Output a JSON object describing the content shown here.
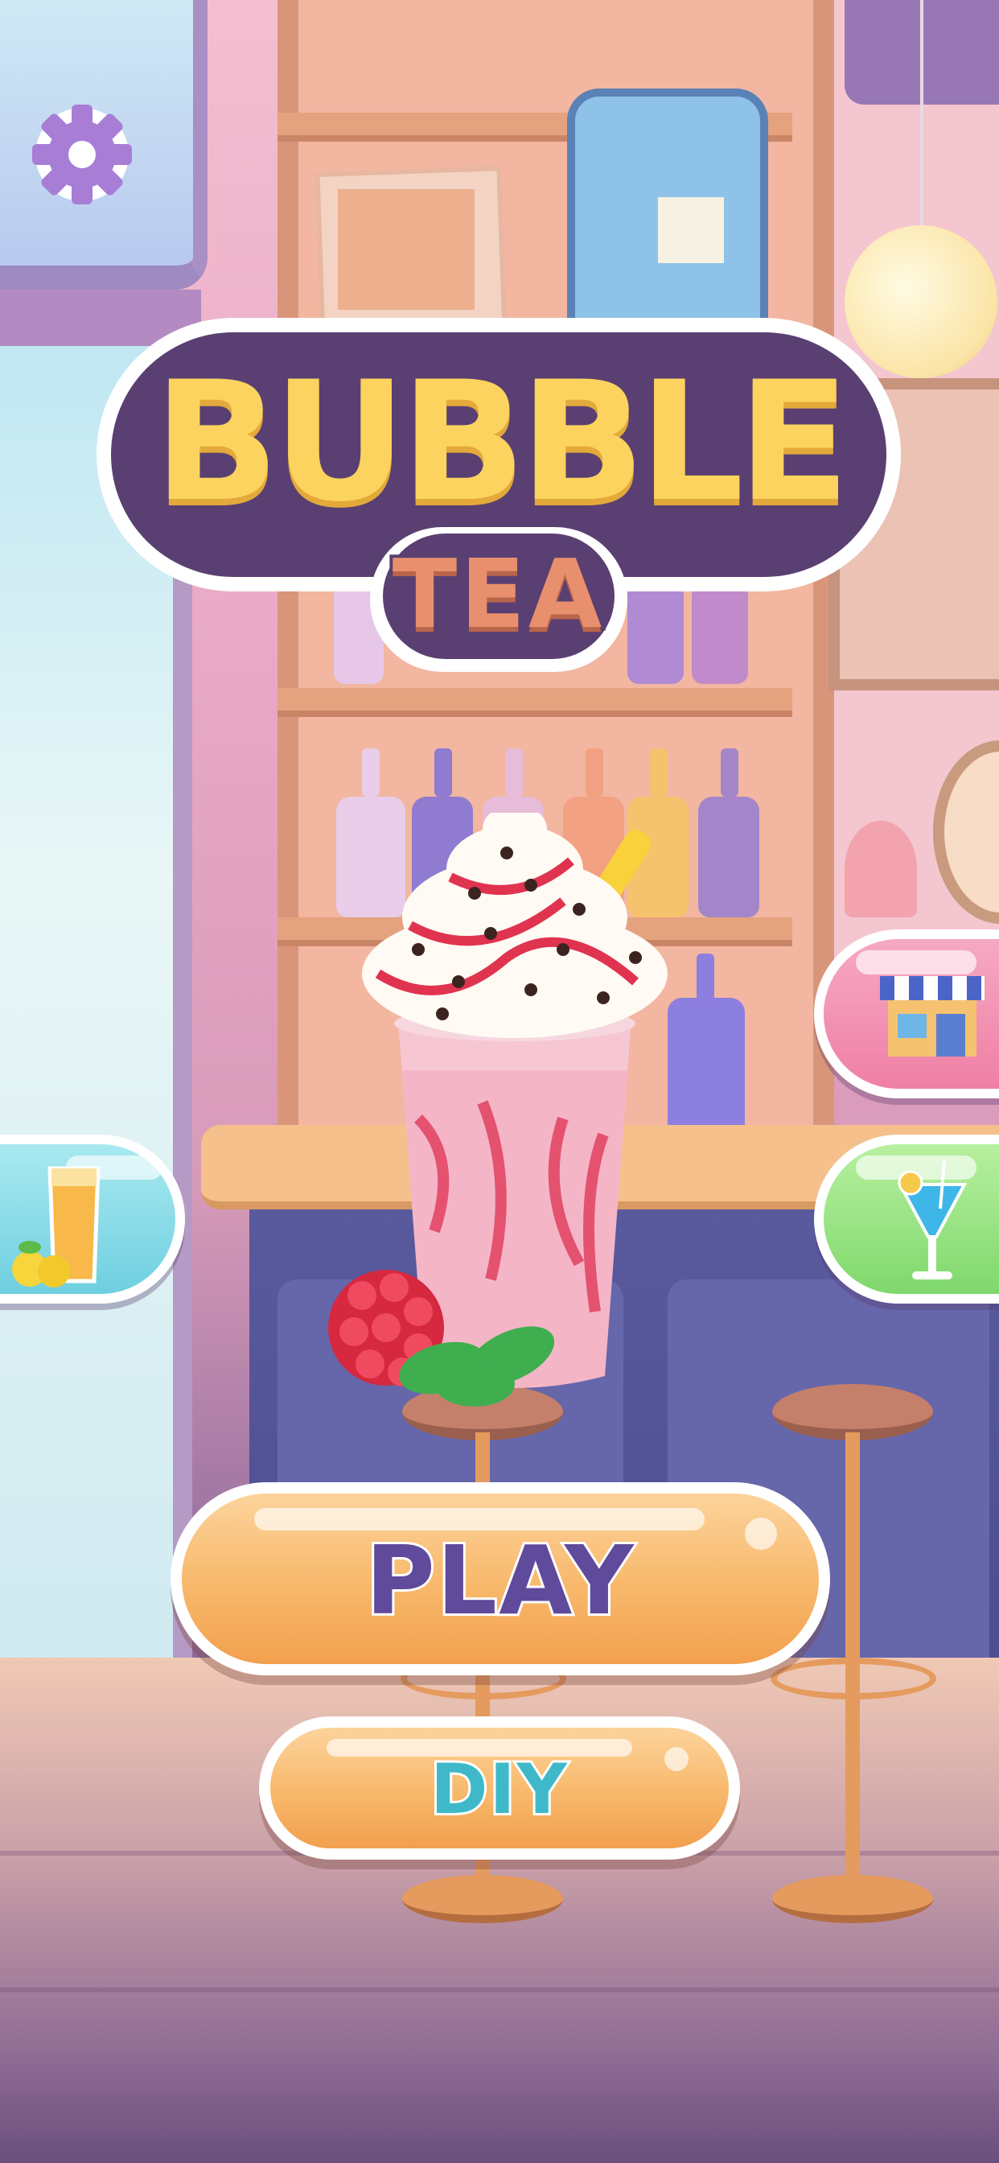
{
  "game": {
    "title": "BUBBLE",
    "subtitle": "TEA"
  },
  "buttons": {
    "play_label": "PLAY",
    "diy_label": "DIY"
  },
  "icons": {
    "settings": "gear-icon",
    "shop": "shop-icon",
    "drink": "cocktail-icon",
    "juice": "lemonade-icon",
    "featured": "raspberry-frappe-icon"
  },
  "colors": {
    "title_fill": "#fbd35e",
    "title_outline": "#5a3f72",
    "subtitle_fill": "#e8906d",
    "play_text": "#5f4a9b",
    "diy_text": "#3fb9c9",
    "button_orange": "#f8b86b",
    "shop_pink": "#ef7fa5",
    "drink_green": "#7fd86c",
    "juice_blue": "#6fcfe0",
    "settings_purple": "#a77dd6"
  }
}
